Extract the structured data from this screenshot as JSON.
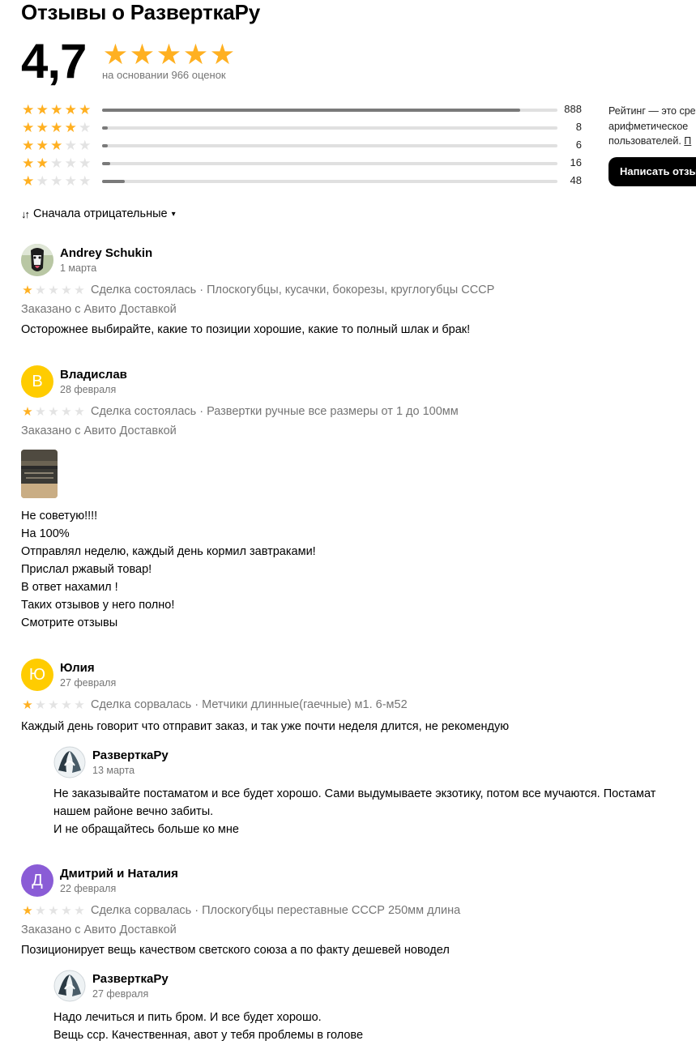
{
  "header": {
    "title": "Отзывы о РазверткаРу"
  },
  "summary": {
    "rating": "4,7",
    "stars_filled": 5,
    "based_on": "на основании 966 оценок",
    "accent_color": "#ffb021"
  },
  "distribution": [
    {
      "stars": 5,
      "count": "888",
      "fraction": 0.919
    },
    {
      "stars": 4,
      "count": "8",
      "fraction": 0.008
    },
    {
      "stars": 3,
      "count": "6",
      "fraction": 0.006
    },
    {
      "stars": 2,
      "count": "16",
      "fraction": 0.017
    },
    {
      "stars": 1,
      "count": "48",
      "fraction": 0.05
    }
  ],
  "side": {
    "note_line1": "Рейтинг — это сре",
    "note_line2": "арифметическое",
    "note_line3_prefix": "пользователей. ",
    "note_line3_link": "П",
    "write_button": "Написать отзыв"
  },
  "sort": {
    "icon": "sort-icon",
    "label": "Сначала отрицательные"
  },
  "reviews": [
    {
      "name": "Andrey Schukin",
      "date": "1 марта",
      "avatar_type": "photo",
      "rating": 1,
      "meta": "Сделка состоялась · Плоскогубцы, кусачки, бокорезы, круглогубцы СССР",
      "delivery": "Заказано с Авито Доставкой",
      "text": "Осторожнее выбирайте, какие то позиции хорошие, какие то полный шлак и брак!"
    },
    {
      "name": "Владислав",
      "date": "28 февраля",
      "avatar_letter": "В",
      "avatar_color": "#ffcc00",
      "rating": 1,
      "meta": "Сделка состоялась · Развертки ручные все размеры от 1 до 100мм",
      "delivery": "Заказано с Авито Доставкой",
      "text": "Не советую!!!!\nНа 100%\nОтправлял неделю, каждый день кормил завтраками!\nПрислал ржавый товар!\nВ ответ нахамил !\nТаких отзывов у него полно!\nСмотрите отзывы"
    },
    {
      "name": "Юлия",
      "date": "27 февраля",
      "avatar_letter": "Ю",
      "avatar_color": "#ffcc00",
      "rating": 1,
      "meta": "Сделка сорвалась · Метчики длинные(гаечные) м1. 6-м52",
      "text": "Каждый день говорит что отправит заказ, и так уже почти неделя длится, не рекомендую",
      "reply": {
        "name": "РазверткаРу",
        "date": "13 марта",
        "text": "Не заказывайте постаматом и все будет хорошо. Сами выдумываете экзотику, потом все мучаются. Постамат\nнашем районе вечно забиты.\nИ не обращайтесь больше ко мне"
      }
    },
    {
      "name": "Дмитрий и Наталия",
      "date": "22 февраля",
      "avatar_letter": "Д",
      "avatar_color": "#8a5cd6",
      "rating": 1,
      "meta": "Сделка сорвалась · Плоскогубцы переставные СССР 250мм длина",
      "delivery": "Заказано с Авито Доставкой",
      "text": "Позиционирует вещь качеством светского союза а по факту дешевей новодел",
      "reply": {
        "name": "РазверткаРу",
        "date": "27 февраля",
        "text": "Надо лечиться и пить бром. И все будет хорошо.\nВещь сср. Качественная, авот у тебя проблемы в голове"
      }
    }
  ]
}
